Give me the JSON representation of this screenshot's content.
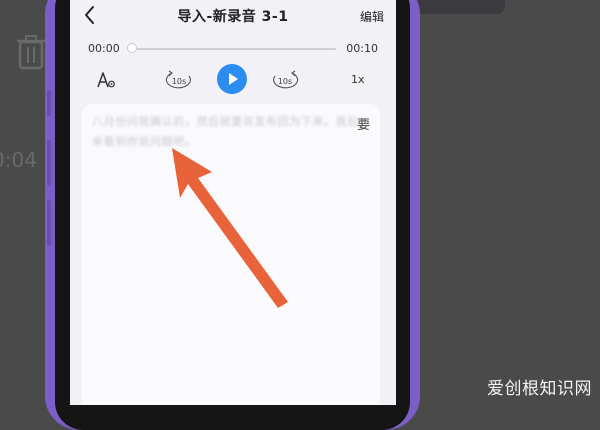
{
  "header": {
    "title": "导入-新录音 3-1",
    "edit_label": "编辑"
  },
  "player": {
    "current_time": "00:00",
    "total_time": "00:10",
    "progress": 0.0,
    "skip_back_label": "10s",
    "skip_forward_label": "10s",
    "speed_label": "1x"
  },
  "transcript": {
    "text": "八月份问我确认的，然后就要说发布因为下来。我后来看到你说问题吧。",
    "edge_char": "要"
  },
  "background": {
    "time_fragment": "0:04"
  },
  "watermark": "爱创根知识网",
  "colors": {
    "accent": "#2d8cf0",
    "arrow": "#e8623a",
    "phone_frame": "#7b5fc7"
  }
}
